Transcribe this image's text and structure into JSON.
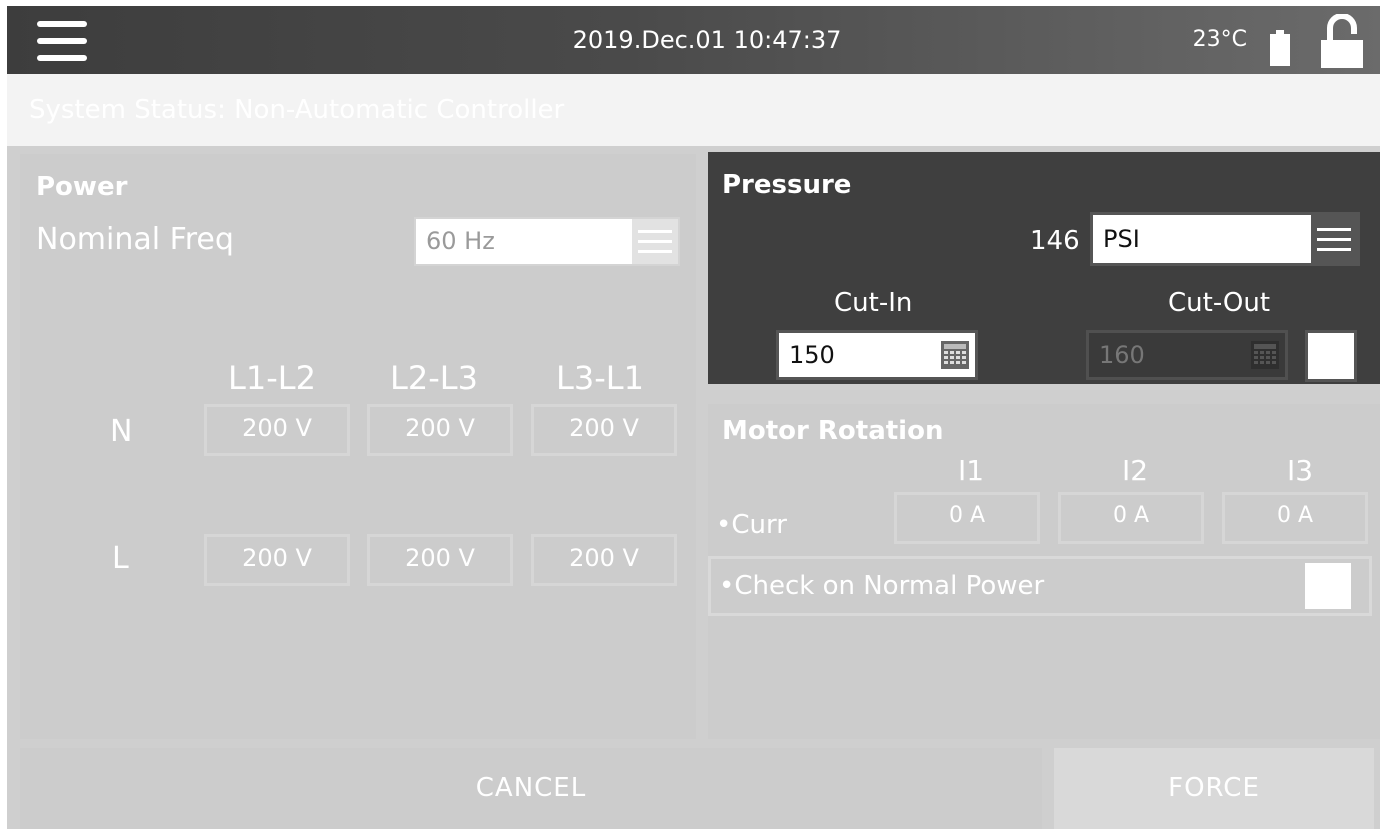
{
  "header": {
    "datetime": "2019.Dec.01 10:47:37",
    "temperature": "23°C",
    "icons": [
      "hamburger-menu-icon",
      "battery-icon",
      "lock-open-icon"
    ]
  },
  "status": {
    "text": "System Status: Non-Automatic Controller"
  },
  "power": {
    "title": "Power",
    "nominal_freq_label": "Nominal Freq",
    "nominal_freq_value": "60 Hz",
    "columns": [
      "L1-L2",
      "L2-L3",
      "L3-L1"
    ],
    "rows": [
      {
        "label": "N",
        "values": [
          "200 V",
          "200 V",
          "200 V"
        ]
      },
      {
        "label": "L",
        "values": [
          "200 V",
          "200 V",
          "200 V"
        ]
      }
    ]
  },
  "pressure": {
    "title": "Pressure",
    "reading": "146",
    "unit": "PSI",
    "cut_in_label": "Cut-In",
    "cut_in_value": "150",
    "cut_out_label": "Cut-Out",
    "cut_out_value": "160"
  },
  "motor": {
    "title": "Motor Rotation",
    "columns": [
      "I1",
      "I2",
      "I3"
    ],
    "curr_label": "•Curr",
    "curr_values": [
      "0 A",
      "0 A",
      "0 A"
    ],
    "normal_power_label": "•Check on Normal Power"
  },
  "buttons": {
    "cancel": "CANCEL",
    "force": "FORCE"
  }
}
